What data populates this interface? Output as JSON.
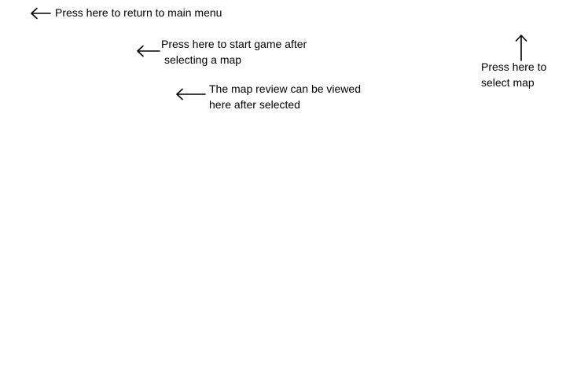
{
  "annotations": {
    "return_menu": {
      "arrow": "left-arrow-icon",
      "text": "Press here to return to main menu"
    },
    "start_game": {
      "arrow": "left-arrow-icon",
      "lines": [
        "Press here to start game after",
        "selecting a map"
      ]
    },
    "map_preview": {
      "arrow": "left-arrow-icon",
      "lines": [
        "The map review can be viewed",
        "here after selected"
      ]
    },
    "select_map": {
      "arrow": "up-arrow-icon",
      "lines": [
        "Press here to",
        "select map"
      ]
    }
  },
  "colors": {
    "background": "#ffffff",
    "ink": "#000000"
  }
}
